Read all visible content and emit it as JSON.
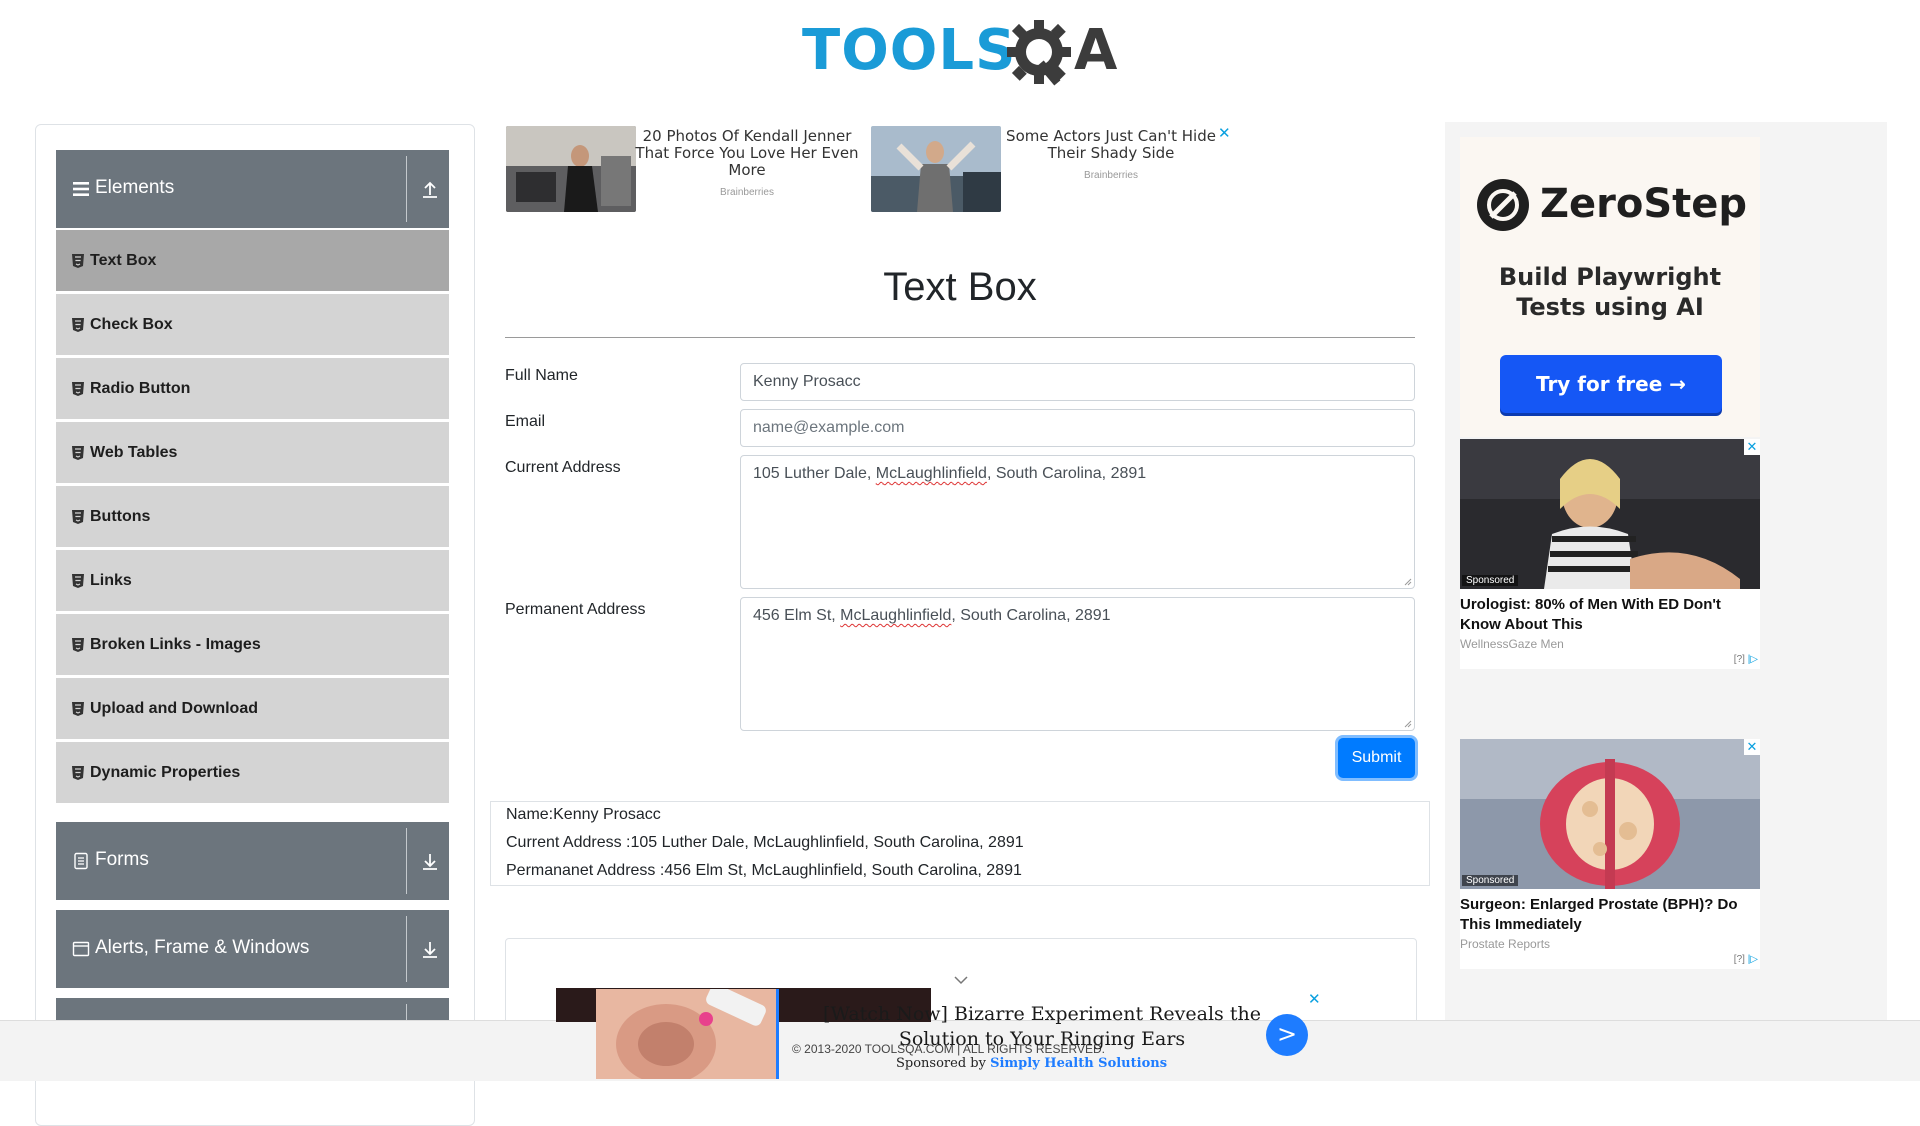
{
  "logo": {
    "part1": "TOOLS",
    "part2": "QA"
  },
  "sidebar": {
    "groups": [
      {
        "label": "Elements"
      },
      {
        "label": "Forms"
      },
      {
        "label": "Alerts, Frame & Windows"
      }
    ],
    "items": [
      {
        "label": "Text Box"
      },
      {
        "label": "Check Box"
      },
      {
        "label": "Radio Button"
      },
      {
        "label": "Web Tables"
      },
      {
        "label": "Buttons"
      },
      {
        "label": "Links"
      },
      {
        "label": "Broken Links - Images"
      },
      {
        "label": "Upload and Download"
      },
      {
        "label": "Dynamic Properties"
      }
    ]
  },
  "top_ads": [
    {
      "title": "20 Photos Of Kendall Jenner That Force You Love Her Even More",
      "source": "Brainberries"
    },
    {
      "title": "Some Actors Just Can't Hide Their Shady Side",
      "source": "Brainberries"
    }
  ],
  "page": {
    "title": "Text Box"
  },
  "form": {
    "full_name_label": "Full Name",
    "full_name_value": "Kenny Prosacc",
    "email_label": "Email",
    "email_placeholder": "name@example.com",
    "current_address_label": "Current Address",
    "current_address_value_a": "105 Luther Dale, ",
    "current_address_value_b": "McLaughlinfield",
    "current_address_value_c": ", South Carolina, 2891",
    "permanent_address_label": "Permanent Address",
    "permanent_address_value_a": "456 Elm St, ",
    "permanent_address_value_b": "McLaughlinfield",
    "permanent_address_value_c": ", South Carolina, 2891",
    "submit_label": "Submit"
  },
  "output": {
    "name": "Name:Kenny Prosacc",
    "current_address": "Current Address :105 Luther Dale, McLaughlinfield, South Carolina, 2891",
    "permanent_address": "Permananet Address :456 Elm St, McLaughlinfield, South Carolina, 2891"
  },
  "right_ads": {
    "zerostep": {
      "brand": "ZeroStep",
      "headline_1": "Build Playwright",
      "headline_2": "Tests using AI",
      "cta": "Try for free →"
    },
    "card1": {
      "sponsored": "Sponsored",
      "headline": "Urologist: 80% of Men With ED Don't Know About This",
      "source": "WellnessGaze Men",
      "info": "[?]"
    },
    "card2": {
      "sponsored": "Sponsored",
      "headline": "Surgeon: Enlarged Prostate (BPH)? Do This Immediately",
      "source": "Prostate Reports",
      "info": "[?]"
    }
  },
  "bottom_ad": {
    "line1": "[Watch Now] Bizarre Experiment Reveals the",
    "line2": "Solution to Your Ringing Ears",
    "sponsored_prefix": "Sponsored by ",
    "sponsor": "Simply Health Solutions",
    "next": ">"
  },
  "footer": {
    "text": "© 2013-2020 TOOLSQA.COM | ALL RIGHTS RESERVED."
  },
  "colors": {
    "header_gray": "#6c757d",
    "active_item": "#a8a8a8",
    "item_bg": "#d4d4d4",
    "primary": "#007bff",
    "logo_blue": "#1a9bd7",
    "logo_dark": "#3c3c3c"
  }
}
